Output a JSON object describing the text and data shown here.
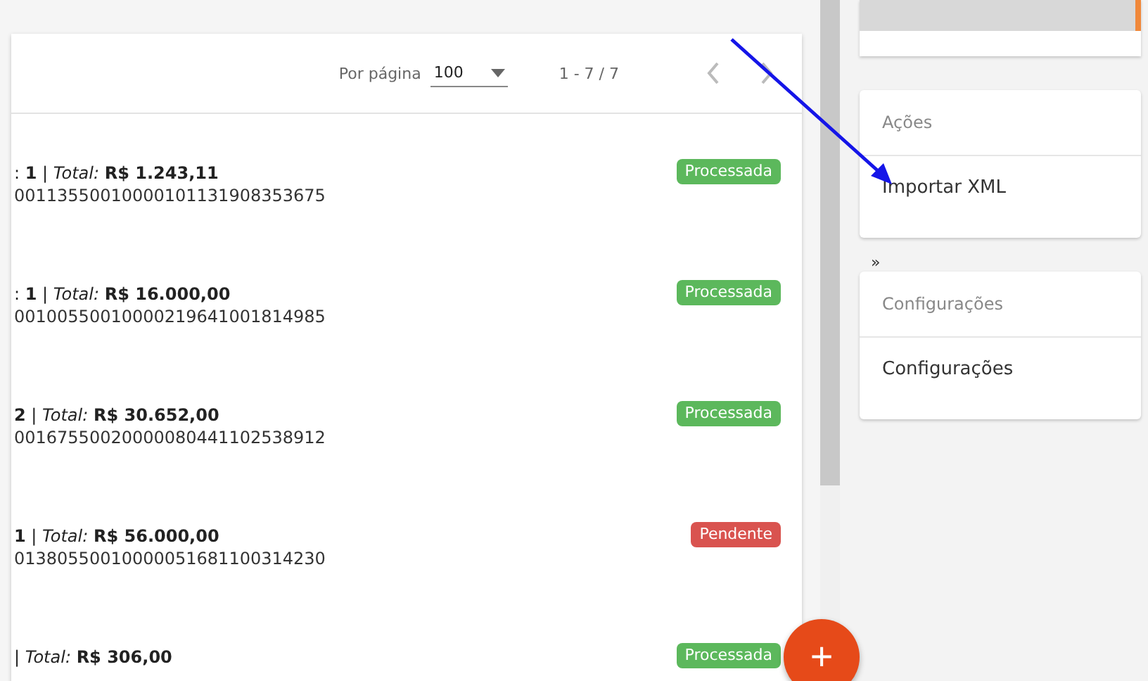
{
  "pagination": {
    "per_page_label": "Por página",
    "per_page_value": "100",
    "range": "1 - 7 / 7"
  },
  "rows": [
    {
      "summary": ": **1** | *Total:* **R$ 1.243,11**",
      "code": "00113550010000101131908353675",
      "status": "Processada",
      "color": "#5cb85c"
    },
    {
      "summary": ": **1** | *Total:* **R$ 16.000,00**",
      "code": "00100550010000219641001814985",
      "status": "Processada",
      "color": "#5cb85c"
    },
    {
      "summary": "**2** | *Total:* **R$ 30.652,00**",
      "code": "00167550020000080441102538912",
      "status": "Processada",
      "color": "#5cb85c"
    },
    {
      "summary": "**1** | *Total:* **R$ 56.000,00**",
      "code": "01380550010000051681100314230",
      "status": "Pendente",
      "color": "#d9534f"
    },
    {
      "summary": "| *Total:* **R$ 306,00**",
      "status": "Processada",
      "color": "#5cb85c"
    }
  ],
  "fab": "+",
  "sidebar": [
    {
      "kind": "top"
    },
    {
      "kind": "card",
      "title": "Ações",
      "link": "Importar XML"
    },
    {
      "kind": "chevron",
      "text": "»"
    },
    {
      "kind": "card",
      "title": "Configurações",
      "link": "Configurações"
    }
  ]
}
